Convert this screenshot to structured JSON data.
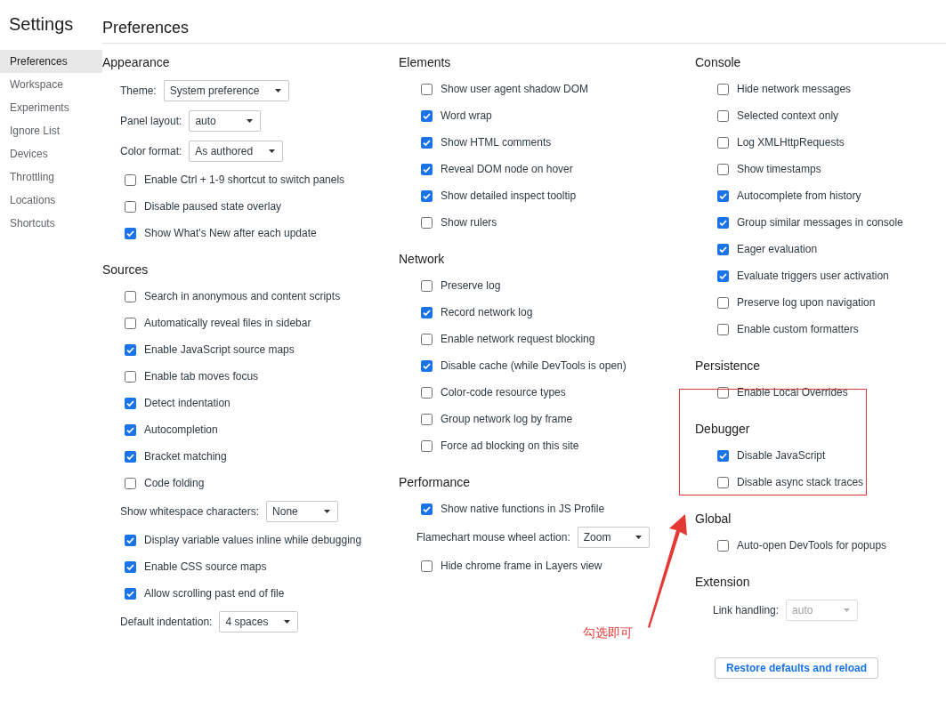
{
  "sidebar": {
    "title": "Settings",
    "items": [
      {
        "label": "Preferences",
        "selected": true
      },
      {
        "label": "Workspace",
        "selected": false
      },
      {
        "label": "Experiments",
        "selected": false
      },
      {
        "label": "Ignore List",
        "selected": false
      },
      {
        "label": "Devices",
        "selected": false
      },
      {
        "label": "Throttling",
        "selected": false
      },
      {
        "label": "Locations",
        "selected": false
      },
      {
        "label": "Shortcuts",
        "selected": false
      }
    ]
  },
  "page_title": "Preferences",
  "columns": [
    [
      {
        "title": "Appearance",
        "highlighted": false,
        "items": [
          {
            "kind": "select",
            "label": "Theme:",
            "value": "System preference",
            "disabled": false
          },
          {
            "kind": "select",
            "label": "Panel layout:",
            "value": "auto",
            "disabled": false
          },
          {
            "kind": "select",
            "label": "Color format:",
            "value": "As authored",
            "disabled": false
          },
          {
            "kind": "checkbox",
            "label": "Enable Ctrl + 1-9 shortcut to switch panels",
            "checked": false
          },
          {
            "kind": "checkbox",
            "label": "Disable paused state overlay",
            "checked": false
          },
          {
            "kind": "checkbox",
            "label": "Show What's New after each update",
            "checked": true
          }
        ]
      },
      {
        "title": "Sources",
        "highlighted": false,
        "items": [
          {
            "kind": "checkbox",
            "label": "Search in anonymous and content scripts",
            "checked": false
          },
          {
            "kind": "checkbox",
            "label": "Automatically reveal files in sidebar",
            "checked": false
          },
          {
            "kind": "checkbox",
            "label": "Enable JavaScript source maps",
            "checked": true
          },
          {
            "kind": "checkbox",
            "label": "Enable tab moves focus",
            "checked": false
          },
          {
            "kind": "checkbox",
            "label": "Detect indentation",
            "checked": true
          },
          {
            "kind": "checkbox",
            "label": "Autocompletion",
            "checked": true
          },
          {
            "kind": "checkbox",
            "label": "Bracket matching",
            "checked": true
          },
          {
            "kind": "checkbox",
            "label": "Code folding",
            "checked": false
          },
          {
            "kind": "select",
            "label": "Show whitespace characters:",
            "value": "None",
            "disabled": false
          },
          {
            "kind": "checkbox",
            "label": "Display variable values inline while debugging",
            "checked": true
          },
          {
            "kind": "checkbox",
            "label": "Enable CSS source maps",
            "checked": true
          },
          {
            "kind": "checkbox",
            "label": "Allow scrolling past end of file",
            "checked": true
          },
          {
            "kind": "select",
            "label": "Default indentation:",
            "value": "4 spaces",
            "disabled": false
          }
        ]
      }
    ],
    [
      {
        "title": "Elements",
        "highlighted": false,
        "items": [
          {
            "kind": "checkbox",
            "label": "Show user agent shadow DOM",
            "checked": false
          },
          {
            "kind": "checkbox",
            "label": "Word wrap",
            "checked": true
          },
          {
            "kind": "checkbox",
            "label": "Show HTML comments",
            "checked": true
          },
          {
            "kind": "checkbox",
            "label": "Reveal DOM node on hover",
            "checked": true
          },
          {
            "kind": "checkbox",
            "label": "Show detailed inspect tooltip",
            "checked": true
          },
          {
            "kind": "checkbox",
            "label": "Show rulers",
            "checked": false
          }
        ]
      },
      {
        "title": "Network",
        "highlighted": false,
        "items": [
          {
            "kind": "checkbox",
            "label": "Preserve log",
            "checked": false
          },
          {
            "kind": "checkbox",
            "label": "Record network log",
            "checked": true
          },
          {
            "kind": "checkbox",
            "label": "Enable network request blocking",
            "checked": false
          },
          {
            "kind": "checkbox",
            "label": "Disable cache (while DevTools is open)",
            "checked": true
          },
          {
            "kind": "checkbox",
            "label": "Color-code resource types",
            "checked": false
          },
          {
            "kind": "checkbox",
            "label": "Group network log by frame",
            "checked": false
          },
          {
            "kind": "checkbox",
            "label": "Force ad blocking on this site",
            "checked": false
          }
        ]
      },
      {
        "title": "Performance",
        "highlighted": false,
        "items": [
          {
            "kind": "checkbox",
            "label": "Show native functions in JS Profile",
            "checked": true
          },
          {
            "kind": "select",
            "label": "Flamechart mouse wheel action:",
            "value": "Zoom",
            "disabled": false
          },
          {
            "kind": "checkbox",
            "label": "Hide chrome frame in Layers view",
            "checked": false
          }
        ]
      }
    ],
    [
      {
        "title": "Console",
        "highlighted": false,
        "items": [
          {
            "kind": "checkbox",
            "label": "Hide network messages",
            "checked": false
          },
          {
            "kind": "checkbox",
            "label": "Selected context only",
            "checked": false
          },
          {
            "kind": "checkbox",
            "label": "Log XMLHttpRequests",
            "checked": false
          },
          {
            "kind": "checkbox",
            "label": "Show timestamps",
            "checked": false
          },
          {
            "kind": "checkbox",
            "label": "Autocomplete from history",
            "checked": true
          },
          {
            "kind": "checkbox",
            "label": "Group similar messages in console",
            "checked": true
          },
          {
            "kind": "checkbox",
            "label": "Eager evaluation",
            "checked": true
          },
          {
            "kind": "checkbox",
            "label": "Evaluate triggers user activation",
            "checked": true
          },
          {
            "kind": "checkbox",
            "label": "Preserve log upon navigation",
            "checked": false
          },
          {
            "kind": "checkbox",
            "label": "Enable custom formatters",
            "checked": false
          }
        ]
      },
      {
        "title": "Persistence",
        "highlighted": false,
        "items": [
          {
            "kind": "checkbox",
            "label": "Enable Local Overrides",
            "checked": false
          }
        ]
      },
      {
        "title": "Debugger",
        "highlighted": true,
        "items": [
          {
            "kind": "checkbox",
            "label": "Disable JavaScript",
            "checked": true
          },
          {
            "kind": "checkbox",
            "label": "Disable async stack traces",
            "checked": false
          }
        ]
      },
      {
        "title": "Global",
        "highlighted": false,
        "items": [
          {
            "kind": "checkbox",
            "label": "Auto-open DevTools for popups",
            "checked": false
          }
        ]
      },
      {
        "title": "Extension",
        "highlighted": false,
        "items": [
          {
            "kind": "select",
            "label": "Link handling:",
            "value": "auto",
            "disabled": true
          },
          {
            "kind": "button",
            "label": "Restore defaults and reload"
          }
        ]
      }
    ]
  ],
  "annotation": {
    "text": "勾选即可"
  }
}
